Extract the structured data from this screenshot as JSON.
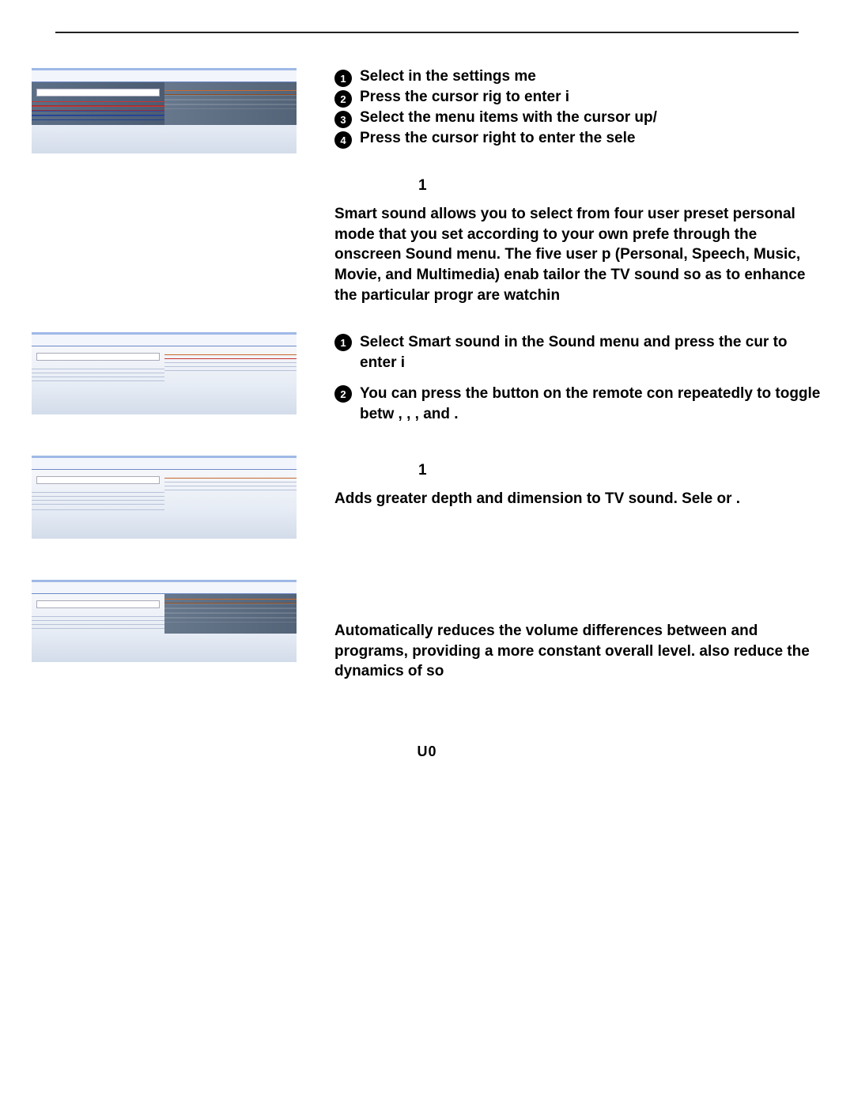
{
  "steps": [
    "Select          in the settings me",
    "Press the cursor rig to enter i",
    "Select the menu items with the cursor up/",
    "Press the cursor right to enter the sele"
  ],
  "sec1_num": "1",
  "sec1_para": "Smart sound allows you to select from four user preset personal mode that you set according to your own prefe through the onscreen Sound menu.  The five user p (Personal, Speech, Music, Movie, and Multimedia) enab tailor the TV sound so as to enhance the particular progr are watchin",
  "sec1_sub1": "Select Smart sound in the Sound menu and press the cur to enter i",
  "sec1_sub2": "You can press the                    button on the remote con repeatedly to toggle betw            ,          ,         , and               .",
  "sec2_num": "1",
  "sec2_para": "Adds greater depth and dimension to TV sound.  Sele or      .",
  "sec3_para": "Automatically reduces the volume differences between and programs, providing a more constant overall level. also reduce the dynamics of so",
  "footer": "U0",
  "menu1": {
    "sel": ""
  },
  "menu2": {
    "sel": ""
  },
  "menu3": {
    "sel": ""
  },
  "menu4": {
    "sel": ""
  }
}
